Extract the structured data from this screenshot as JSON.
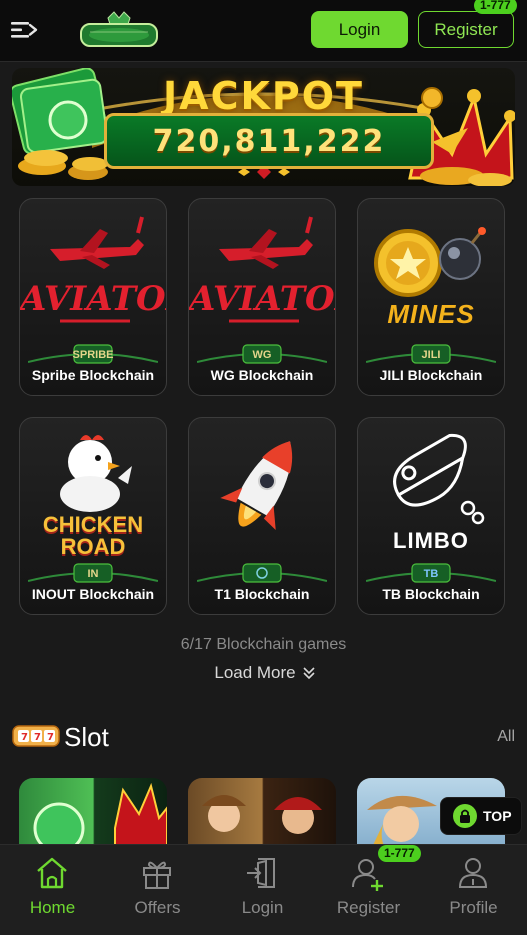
{
  "header": {
    "login_label": "Login",
    "register_label": "Register",
    "register_badge": "1-777"
  },
  "jackpot": {
    "title": "JACKPOT",
    "value": "720,811,222"
  },
  "games": [
    {
      "art": "AVIATOR",
      "provider": "SPRIBE",
      "label": "Spribe Blockchain"
    },
    {
      "art": "AVIATOR",
      "provider": "WG",
      "label": "WG Blockchain"
    },
    {
      "art": "MINES",
      "provider": "JILI",
      "label": "JILI Blockchain"
    },
    {
      "art": "CHICKEN ROAD",
      "provider": "IN",
      "label": "INOUT Blockchain"
    },
    {
      "art": "",
      "provider": "",
      "label": "T1 Blockchain"
    },
    {
      "art": "LIMBO",
      "provider": "TB",
      "label": "TB Blockchain"
    }
  ],
  "games_count": "6/17 Blockchain games",
  "load_more_label": "Load More",
  "slot": {
    "title": "Slot",
    "all_label": "All"
  },
  "top_button_label": "TOP",
  "bottom_nav": {
    "items": [
      {
        "label": "Home",
        "icon": "home-icon",
        "active": true
      },
      {
        "label": "Offers",
        "icon": "gift-icon",
        "active": false
      },
      {
        "label": "Login",
        "icon": "login-icon",
        "active": false
      },
      {
        "label": "Register",
        "icon": "add-user-icon",
        "active": false
      },
      {
        "label": "Profile",
        "icon": "profile-icon",
        "active": false
      }
    ],
    "register_badge": "1-777"
  },
  "colors": {
    "accent": "#6fd930",
    "background": "#1a1a1a",
    "header": "#0c0c0c",
    "gold": "#ffd83a"
  }
}
